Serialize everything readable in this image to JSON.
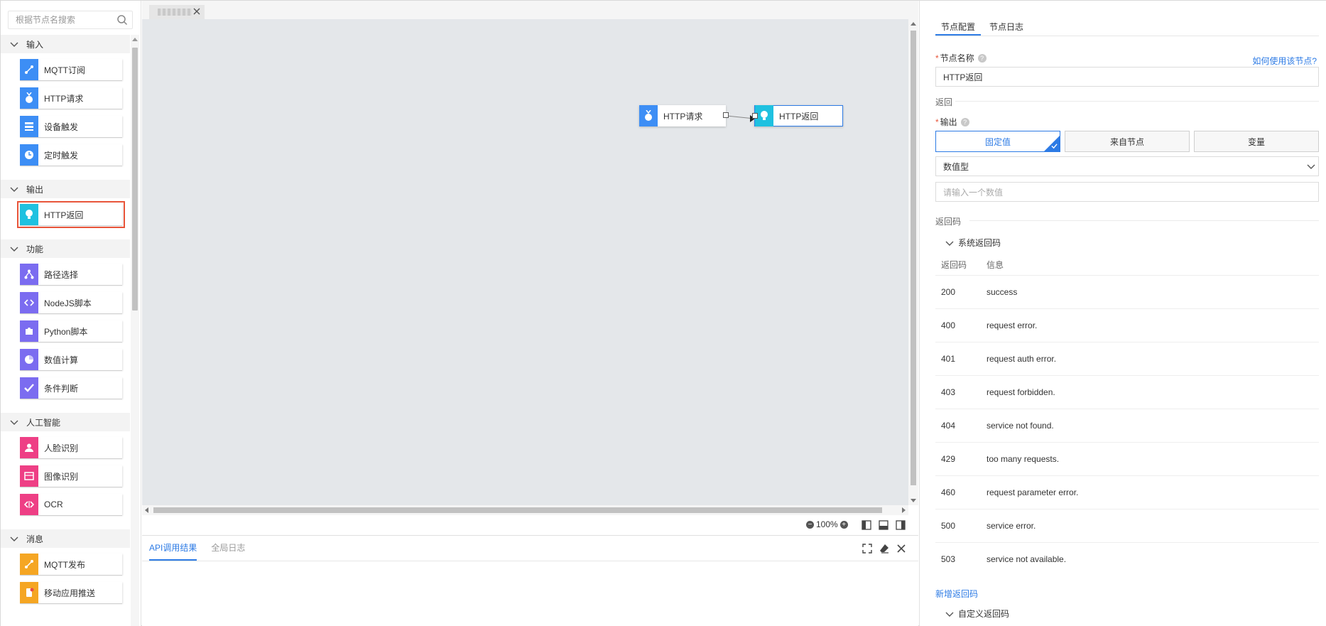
{
  "search": {
    "placeholder": "根据节点名搜索"
  },
  "palette": {
    "groups": [
      {
        "title": "输入",
        "items": [
          {
            "label": "MQTT订阅",
            "icon": "share-icon",
            "color": "#3d8ef5"
          },
          {
            "label": "HTTP请求",
            "icon": "medal-icon",
            "color": "#3d8ef5"
          },
          {
            "label": "设备触发",
            "icon": "stack-icon",
            "color": "#3d8ef5"
          },
          {
            "label": "定时触发",
            "icon": "clock-icon",
            "color": "#3d8ef5"
          }
        ]
      },
      {
        "title": "输出",
        "items": [
          {
            "label": "HTTP返回",
            "icon": "bulb-icon",
            "color": "#1fc1e0",
            "selected": true
          }
        ]
      },
      {
        "title": "功能",
        "items": [
          {
            "label": "路径选择",
            "icon": "branch-icon",
            "color": "#7b6cf0"
          },
          {
            "label": "NodeJS脚本",
            "icon": "code-icon",
            "color": "#7b6cf0"
          },
          {
            "label": "Python脚本",
            "icon": "puzzle-icon",
            "color": "#7b6cf0"
          },
          {
            "label": "数值计算",
            "icon": "pie-icon",
            "color": "#7b6cf0"
          },
          {
            "label": "条件判断",
            "icon": "check-icon",
            "color": "#7b6cf0"
          }
        ]
      },
      {
        "title": "人工智能",
        "items": [
          {
            "label": "人脸识别",
            "icon": "person-icon",
            "color": "#ee3f85"
          },
          {
            "label": "图像识别",
            "icon": "image-icon",
            "color": "#ee3f85"
          },
          {
            "label": "OCR",
            "icon": "ocr-icon",
            "color": "#ee3f85"
          }
        ]
      },
      {
        "title": "消息",
        "items": [
          {
            "label": "MQTT发布",
            "icon": "share-icon",
            "color": "#f5a623"
          },
          {
            "label": "移动应用推送",
            "icon": "push-icon",
            "color": "#f5a623"
          }
        ]
      }
    ]
  },
  "canvas": {
    "nodes": [
      {
        "label": "HTTP请求",
        "color": "#3d8ef5"
      },
      {
        "label": "HTTP返回",
        "color": "#1fc1e0"
      }
    ],
    "zoom": "100%"
  },
  "log": {
    "tabs": [
      "API调用结果",
      "全局日志"
    ]
  },
  "config": {
    "tabs": [
      "节点配置",
      "节点日志"
    ],
    "name_label": "节点名称",
    "help_link": "如何使用该节点?",
    "name_value": "HTTP返回",
    "return_section": "返回",
    "output_label": "输出",
    "segments": [
      "固定值",
      "来自节点",
      "变量"
    ],
    "type_value": "数值型",
    "value_placeholder": "请输入一个数值",
    "code_section": "返回码",
    "system_codes": "系统返回码",
    "table_headers": [
      "返回码",
      "信息"
    ],
    "codes": [
      {
        "code": "200",
        "msg": "success"
      },
      {
        "code": "400",
        "msg": "request error."
      },
      {
        "code": "401",
        "msg": "request auth error."
      },
      {
        "code": "403",
        "msg": "request forbidden."
      },
      {
        "code": "404",
        "msg": "service not found."
      },
      {
        "code": "429",
        "msg": "too many requests."
      },
      {
        "code": "460",
        "msg": "request parameter error."
      },
      {
        "code": "500",
        "msg": "service error."
      },
      {
        "code": "503",
        "msg": "service not available."
      }
    ],
    "add_code": "新增返回码",
    "custom_codes": "自定义返回码"
  },
  "colors": {
    "accent": "#2d7be5",
    "selected_outline": "#e8553a",
    "canvas_bg": "#e4e7ea"
  }
}
